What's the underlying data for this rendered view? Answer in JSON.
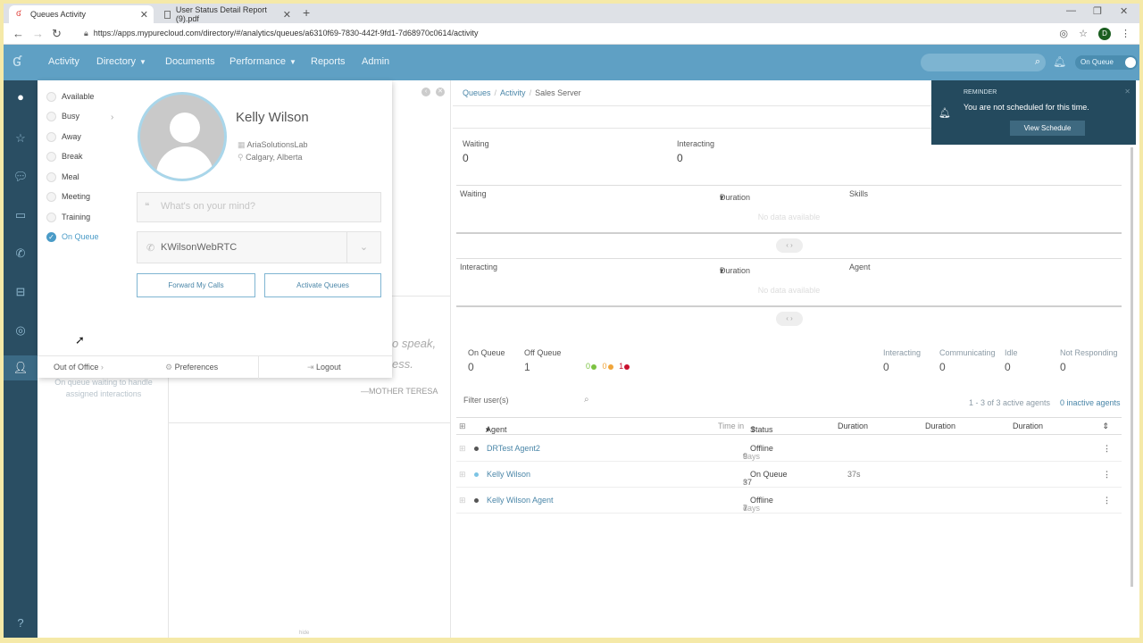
{
  "browser": {
    "tabs": [
      {
        "title": "Queues Activity",
        "active": true
      },
      {
        "title": "User Status Detail Report (9).pdf",
        "active": false
      }
    ],
    "url": "https://apps.mypurecloud.com/directory/#/analytics/queues/a6310f69-7830-442f-9fd1-7d68970c0614/activity",
    "profile_initial": "D"
  },
  "header": {
    "nav": [
      {
        "label": "Activity"
      },
      {
        "label": "Directory",
        "caret": "▼"
      },
      {
        "label": "Documents"
      },
      {
        "label": "Performance",
        "caret": "▼"
      },
      {
        "label": "Reports"
      },
      {
        "label": "Admin"
      }
    ],
    "status_toggle": "On Queue"
  },
  "status_panel": {
    "statuses": [
      {
        "label": "Available"
      },
      {
        "label": "Busy"
      },
      {
        "label": "Away"
      },
      {
        "label": "Break"
      },
      {
        "label": "Meal"
      },
      {
        "label": "Meeting"
      },
      {
        "label": "Training"
      },
      {
        "label": "On Queue",
        "selected": true
      }
    ],
    "user": {
      "name": "Kelly Wilson",
      "org": "AriaSolutionsLab",
      "location": "Calgary, Alberta"
    },
    "mind_placeholder": "What's on your mind?",
    "phone": "KWilsonWebRTC",
    "forward_calls": "Forward My Calls",
    "activate_queues": "Activate Queues",
    "footer": {
      "out_of_office": "Out of Office",
      "preferences": "Preferences",
      "logout": "Logout"
    }
  },
  "left_text": "On queue waiting to handle assigned interactions",
  "middle": {
    "quote_frag1": "o speak,",
    "quote_frag2": "ess.",
    "quote_author": "—MOTHER TERESA",
    "hide": "hide"
  },
  "breadcrumb": {
    "items": [
      "Queues",
      "Activity"
    ],
    "current": "Sales Server"
  },
  "stats": {
    "waiting_label": "Waiting",
    "waiting_value": "0",
    "interacting_label": "Interacting",
    "interacting_value": "0"
  },
  "waiting_table": {
    "col1": "Waiting",
    "col2": "Duration",
    "col3": "Skills",
    "empty": "No data available"
  },
  "interacting_table": {
    "col1": "Interacting",
    "col2": "Duration",
    "col3": "Agent",
    "empty": "No data available"
  },
  "summary": {
    "on_queue_label": "On Queue",
    "on_queue_value": "0",
    "off_queue_label": "Off Queue",
    "off_queue_value": "1",
    "dot_counts": [
      "0",
      "0",
      "1"
    ],
    "dot_colors": [
      "#7cc242",
      "#f0a53a",
      "#c8102e"
    ],
    "interacting_label": "Interacting",
    "interacting_value": "0",
    "communicating_label": "Communicating",
    "communicating_value": "0",
    "idle_label": "Idle",
    "idle_value": "0",
    "not_responding_label": "Not Responding",
    "not_responding_value": "0"
  },
  "filter": {
    "placeholder": "Filter user(s)",
    "count_text": "1 - 3 of 3 active agents",
    "inactive_text": "0 inactive agents"
  },
  "agents_table": {
    "headers": {
      "agent": "Agent",
      "time_in": "Time in",
      "status": "Status",
      "duration1": "Duration",
      "duration2": "Duration",
      "duration3": "Duration"
    },
    "rows": [
      {
        "name": "DRTest Agent2",
        "time_value": "9",
        "time_unit": "days",
        "status": "Offline",
        "duration": "",
        "presence_color": "#555555"
      },
      {
        "name": "Kelly Wilson",
        "time_value": "37",
        "time_unit": "s",
        "status": "On Queue",
        "duration": "37s",
        "presence_color": "#7cc4e4"
      },
      {
        "name": "Kelly Wilson Agent",
        "time_value": "7",
        "time_unit": "days",
        "status": "Offline",
        "duration": "",
        "presence_color": "#555555"
      }
    ]
  },
  "reminder": {
    "title": "REMINDER",
    "message": "You are not scheduled for this time.",
    "button": "View Schedule"
  },
  "colors": {
    "header": "#5fa0c4",
    "sidebar": "#2a4e63",
    "accent": "#4a9bc7",
    "reminder_bg": "#244a5e"
  }
}
